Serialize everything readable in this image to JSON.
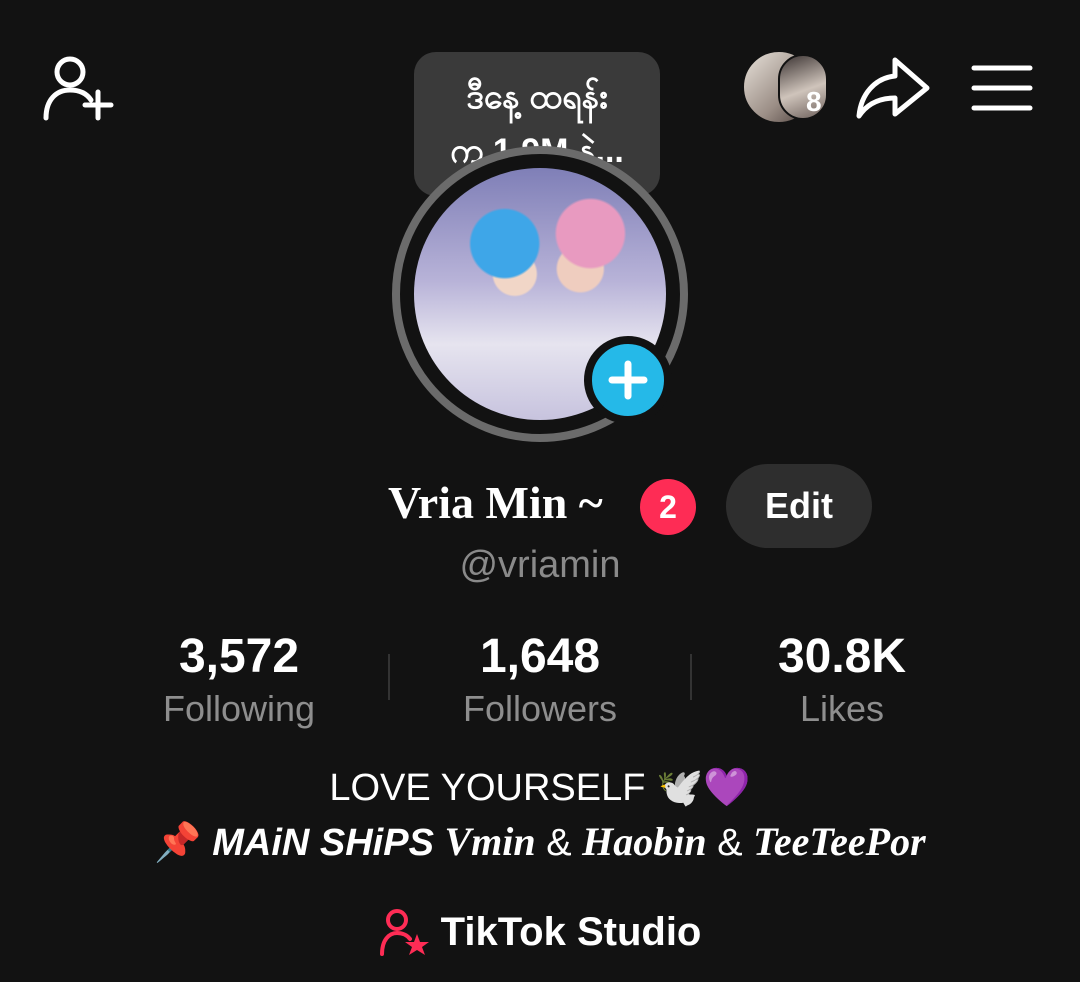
{
  "tooltip": {
    "line1": "ဒီနေ့ ထရန်း",
    "line2": "က 1.9M နဲ့..."
  },
  "viewers": {
    "count": "8"
  },
  "profile": {
    "display_name": "Vria Min ~",
    "notification_count": "2",
    "edit_label": "Edit",
    "username": "@vriamin"
  },
  "stats": [
    {
      "value": "3,572",
      "label": "Following"
    },
    {
      "value": "1,648",
      "label": "Followers"
    },
    {
      "value": "30.8K",
      "label": "Likes"
    }
  ],
  "bio": {
    "line1": "LOVE YOURSELF 🕊️💜",
    "pin_emoji": "📌",
    "main_ships": "MAiN SHiPS",
    "ship1": "Vmin",
    "amp1": "&",
    "ship2": "Haobin",
    "amp2": "&",
    "ship3": "TeeTeePor"
  },
  "studio": {
    "label": "TikTok Studio"
  },
  "colors": {
    "background": "#121212",
    "accent_blue": "#25b9e8",
    "badge_red": "#fe2c55",
    "muted_text": "#8a8a8a",
    "button_bg": "#2e2e2e"
  },
  "icons": [
    "add-friend-icon",
    "share-icon",
    "menu-icon",
    "plus-icon",
    "creator-studio-icon"
  ]
}
